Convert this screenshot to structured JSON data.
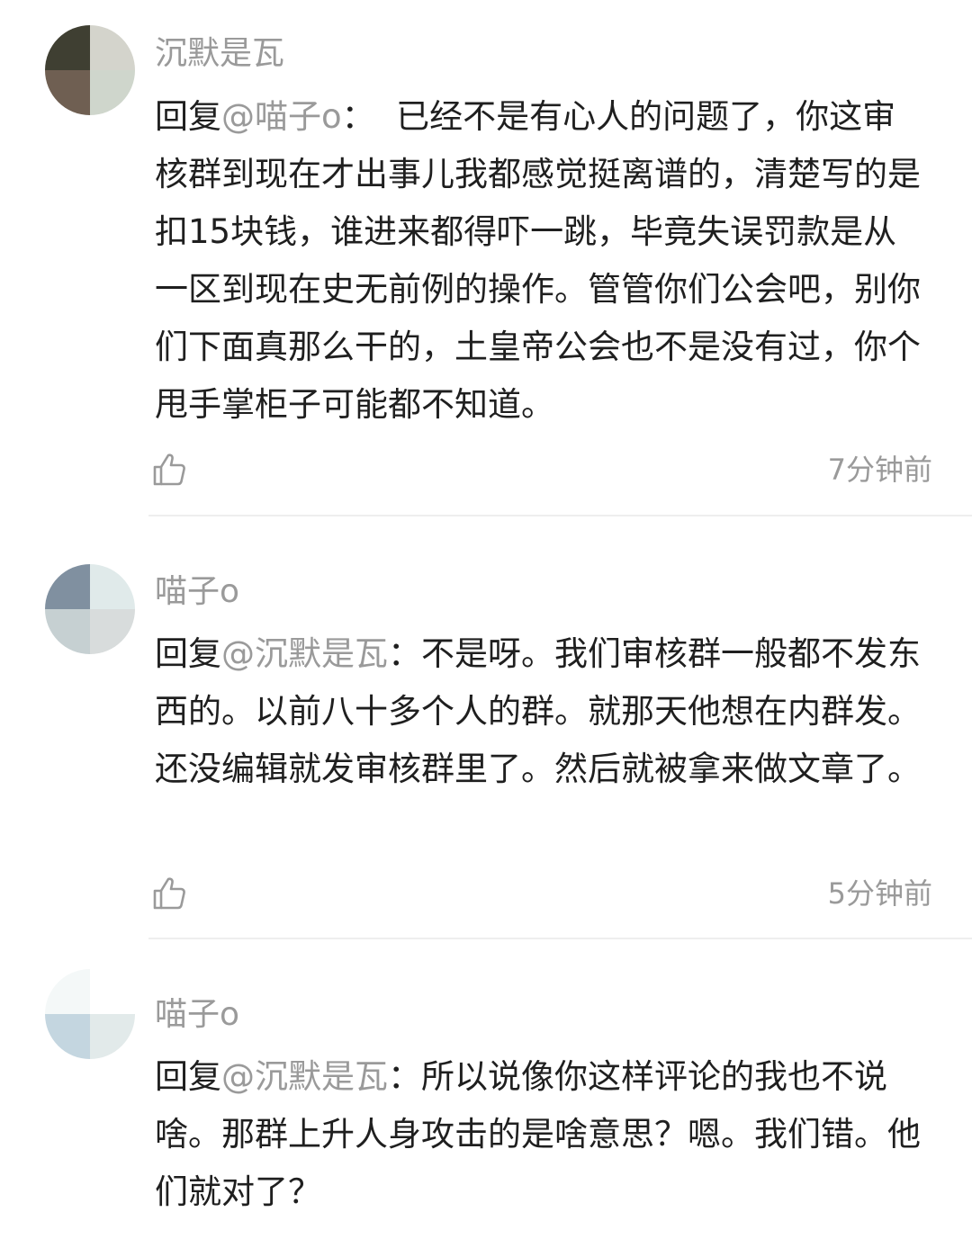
{
  "comments": [
    {
      "username": "沉默是瓦",
      "reply_prefix": "回复",
      "reply_target": "@喵子o",
      "separator": "：",
      "text": "  已经不是有心人的问题了，你这审核群到现在才出事儿我都感觉挺离谱的，清楚写的是扣15块钱，谁进来都得吓一跳，毕竟失误罚款是从一区到现在史无前例的操作。管管你们公会吧，别你们下面真那么干的，土皇帝公会也不是没有过，你个甩手掌柜子可能都不知道。",
      "time": "7分钟前",
      "like_icon": "thumbs-up-icon"
    },
    {
      "username": "喵子o",
      "reply_prefix": "回复",
      "reply_target": "@沉默是瓦",
      "separator": "：",
      "text": "不是呀。我们审核群一般都不发东西的。以前八十多个人的群。就那天他想在内群发。还没编辑就发审核群里了。然后就被拿来做文章了。",
      "time": "5分钟前",
      "like_icon": "thumbs-up-icon"
    },
    {
      "username": "喵子o",
      "reply_prefix": "回复",
      "reply_target": "@沉默是瓦",
      "separator": "：",
      "text": "所以说像你这样评论的我也不说啥。那群上升人身攻击的是啥意思？嗯。我们错。他们就对了？"
    }
  ]
}
